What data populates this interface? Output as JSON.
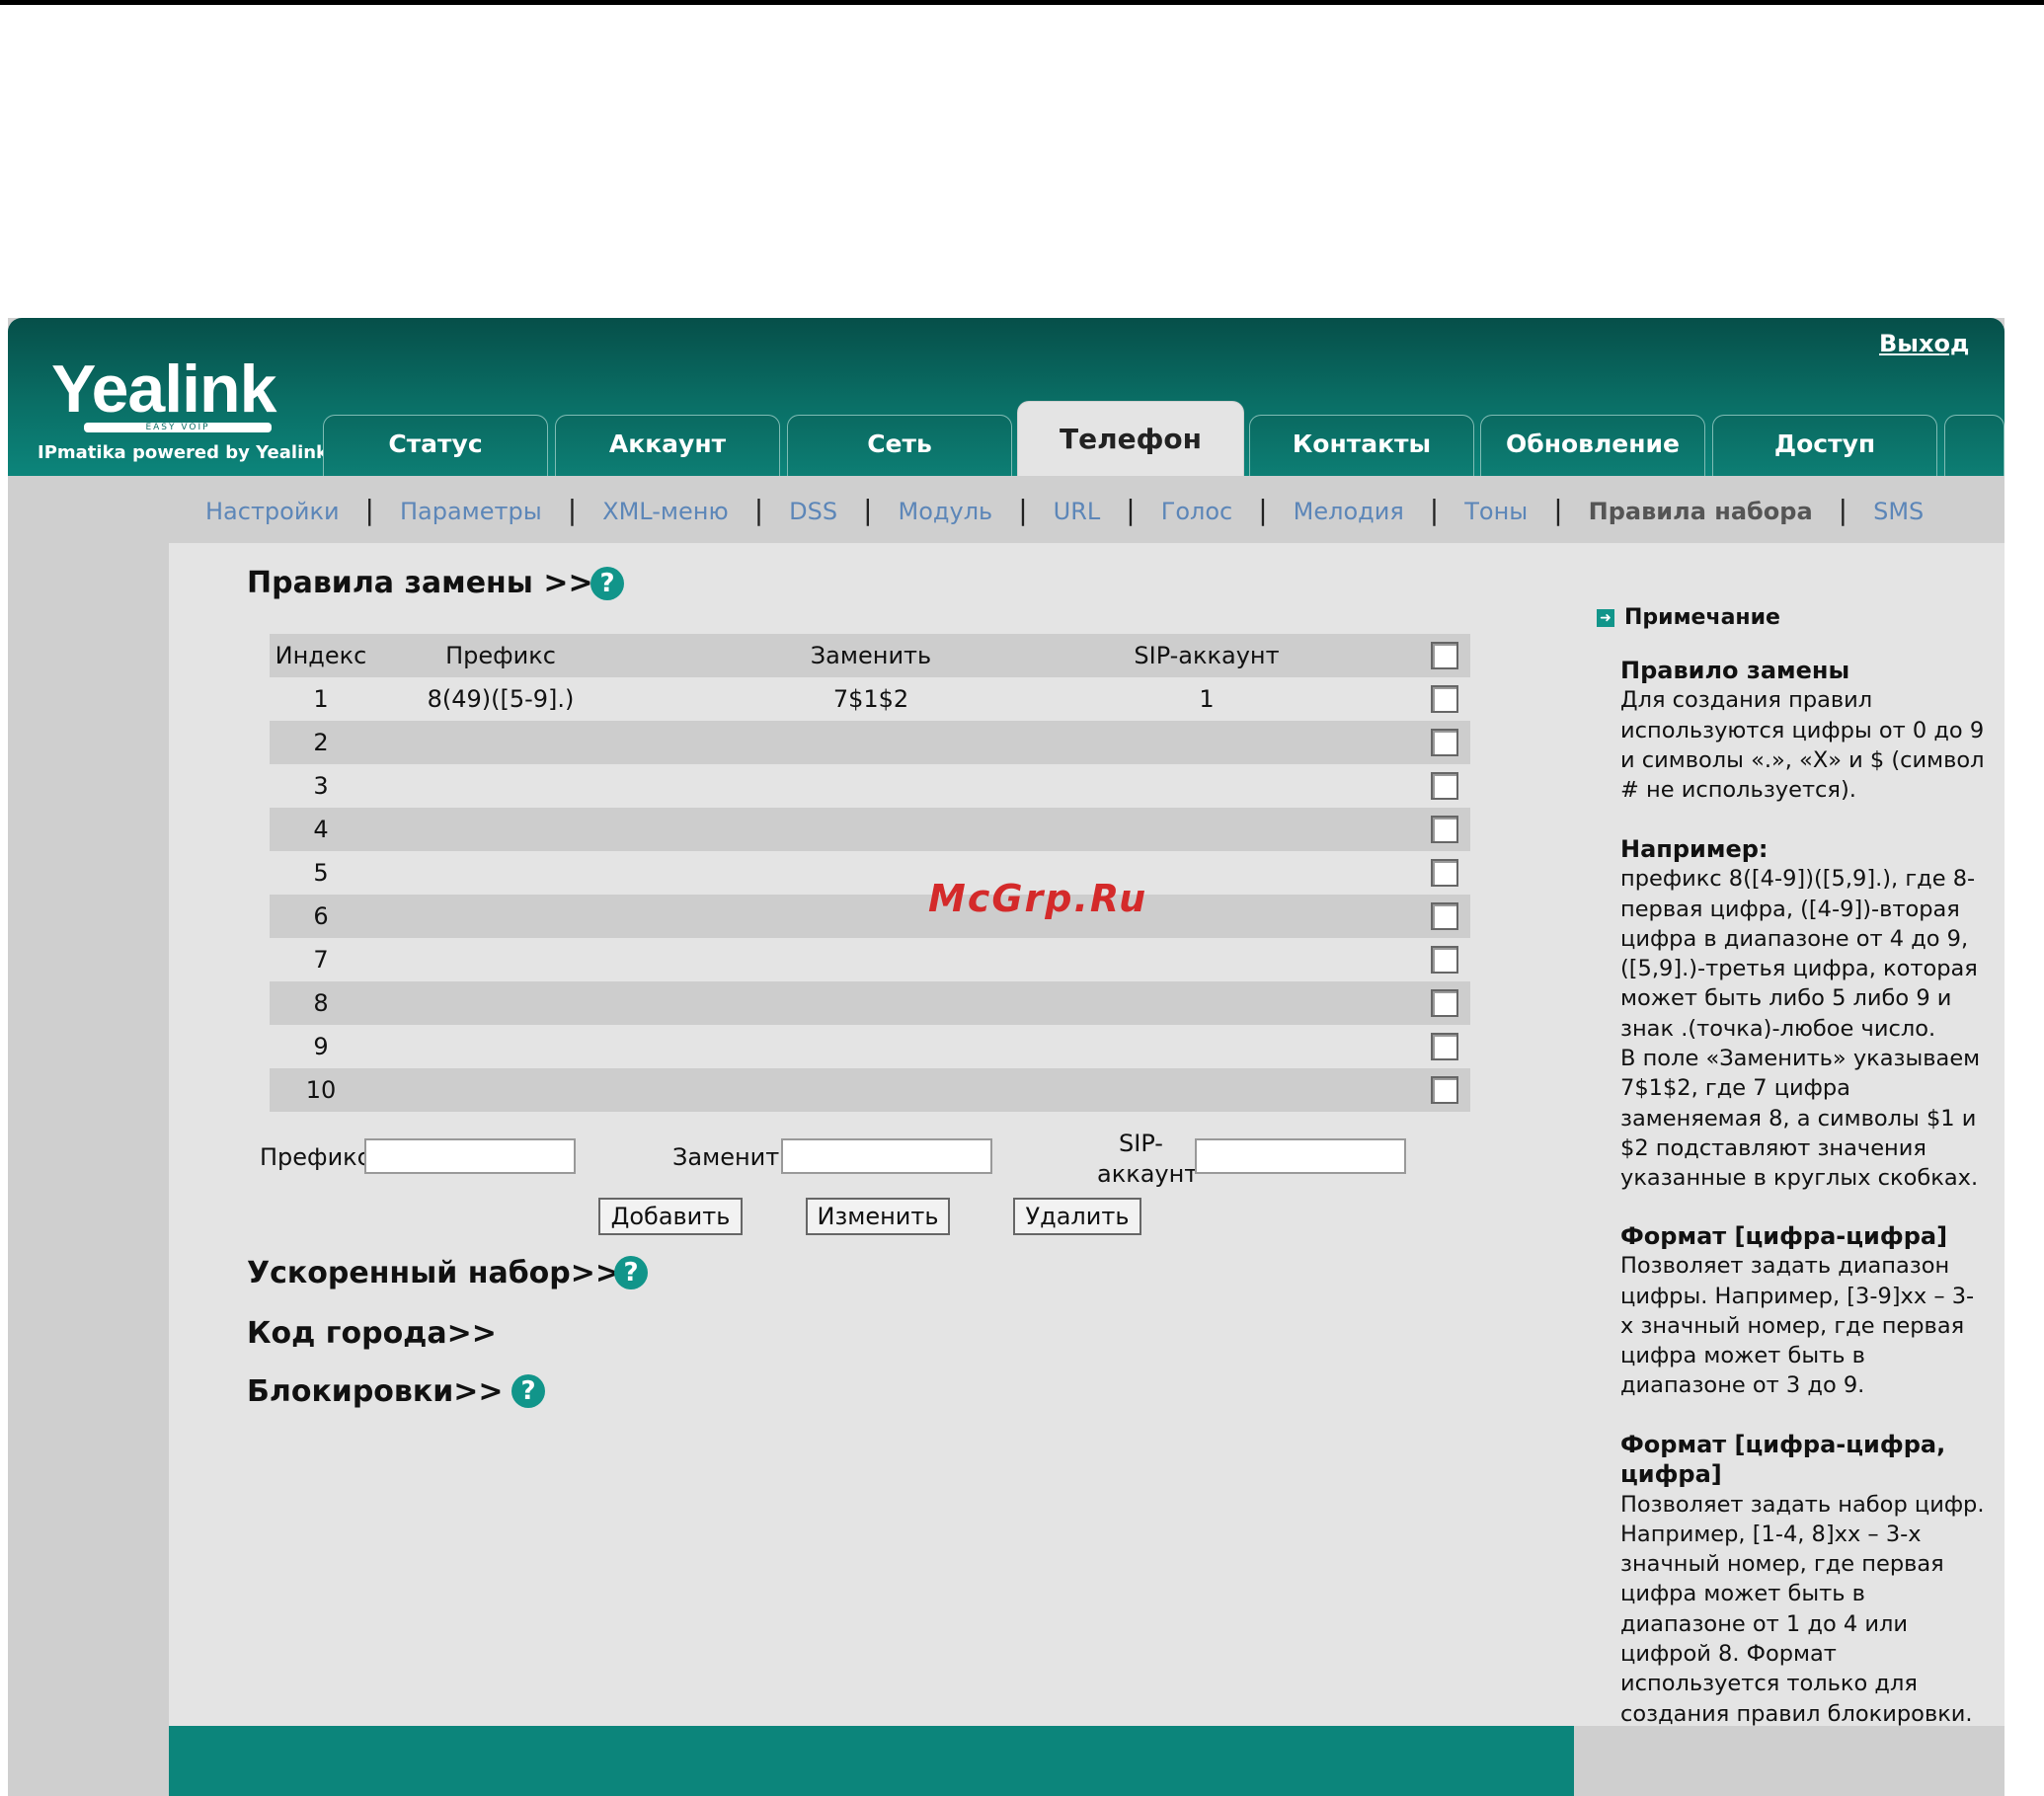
{
  "header": {
    "logo": "Yealink",
    "logo_tagline": "EASY VOIP",
    "logo_sub": "IPmatika powered by Yealink",
    "logout": "Выход"
  },
  "tabs": [
    {
      "label": "Статус"
    },
    {
      "label": "Аккаунт"
    },
    {
      "label": "Сеть"
    },
    {
      "label": "Телефон",
      "active": true
    },
    {
      "label": "Контакты"
    },
    {
      "label": "Обновление"
    },
    {
      "label": "Доступ"
    }
  ],
  "subnav": [
    "Настройки",
    "Параметры",
    "XML-меню",
    "DSS",
    "Модуль",
    "URL",
    "Голос",
    "Мелодия",
    "Тоны",
    "Правила набора",
    "SMS"
  ],
  "sections": {
    "replace_title": "Правила замены >>",
    "speed_dial": "Ускоренный набор>>",
    "area_code": "Код города>>",
    "blocking": "Блокировки>>"
  },
  "table": {
    "headers": {
      "index": "Индекс",
      "prefix": "Префикс",
      "replace": "Заменить",
      "sip": "SIP-аккаунт"
    },
    "rows": [
      {
        "index": "1",
        "prefix": "8(49)([5-9].)",
        "replace": "7$1$2",
        "sip": "1"
      },
      {
        "index": "2",
        "prefix": "",
        "replace": "",
        "sip": ""
      },
      {
        "index": "3",
        "prefix": "",
        "replace": "",
        "sip": ""
      },
      {
        "index": "4",
        "prefix": "",
        "replace": "",
        "sip": ""
      },
      {
        "index": "5",
        "prefix": "",
        "replace": "",
        "sip": ""
      },
      {
        "index": "6",
        "prefix": "",
        "replace": "",
        "sip": ""
      },
      {
        "index": "7",
        "prefix": "",
        "replace": "",
        "sip": ""
      },
      {
        "index": "8",
        "prefix": "",
        "replace": "",
        "sip": ""
      },
      {
        "index": "9",
        "prefix": "",
        "replace": "",
        "sip": ""
      },
      {
        "index": "10",
        "prefix": "",
        "replace": "",
        "sip": ""
      }
    ]
  },
  "form": {
    "prefix_label": "Префикс",
    "replace_label": "Заменить",
    "sip_label_1": "SIP-",
    "sip_label_2": "аккаунт",
    "prefix_value": "",
    "replace_value": "",
    "sip_value": "",
    "add": "Добавить",
    "edit": "Изменить",
    "delete": "Удалить"
  },
  "watermark": "McGrp.Ru",
  "note": {
    "heading": "Примечание",
    "t1": "Правило замены",
    "b1": "Для создания правил используются цифры от 0 до 9 и символы «.», «X» и $ (символ # не используется).",
    "t2": "Например:",
    "b2a": "префикс 8([4-9])([5,9].), где 8-первая цифра, ([4-9])-вторая цифра в диапазоне от 4 до 9, ([5,9].)-третья цифра, которая может быть либо 5 либо 9 и знак .(точка)-любое число.",
    "b2b": "В поле «Заменить» указываем 7$1$2, где 7 цифра заменяемая 8, а символы $1 и $2 подставляют значения указанные в круглых скобках.",
    "t3": "Формат [цифра-цифра]",
    "b3": "Позволяет задать диапазон цифры. Например, [3-9]xx – 3-х значный номер, где первая цифра может быть в диапазоне от 3 до 9.",
    "t4": "Формат [цифра-цифра, цифра]",
    "b4": "Позволяет задать набор цифр. Например, [1-4, 8]xx – 3-х значный номер, где первая цифра может быть в диапазоне от 1 до 4 или цифрой 8. Формат используется только для создания правил блокировки."
  }
}
